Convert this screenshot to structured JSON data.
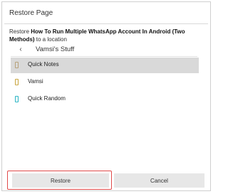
{
  "dialog": {
    "title": "Restore Page",
    "description_prefix": "Restore ",
    "description_page": "How To Run Multiple WhatsApp Account In Android (Two Methods)",
    "description_suffix": " to a location"
  },
  "navigation": {
    "back_icon": "chevron-left-icon",
    "current": "Vamsi's Stuff"
  },
  "locations": [
    {
      "label": "Quick Notes",
      "selected": true,
      "icon": "notebook-icon",
      "icon_color": "#b8a27a"
    },
    {
      "label": "Vamsi",
      "selected": false,
      "icon": "notebook-icon",
      "icon_color": "#c9a640"
    },
    {
      "label": "Quick Random",
      "selected": false,
      "icon": "notebook-icon",
      "icon_color": "#2bb5c4"
    }
  ],
  "buttons": {
    "restore": "Restore",
    "cancel": "Cancel"
  },
  "colors": {
    "selection": "#d9d9d9",
    "button": "#e7e7e7",
    "highlight": "#e04a4a"
  }
}
